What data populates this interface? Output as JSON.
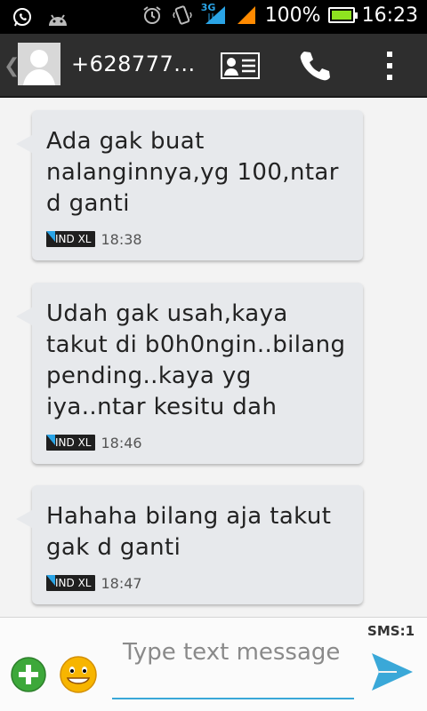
{
  "status_bar": {
    "network_type": "3G",
    "battery_percent": "100%",
    "battery_level": 1.0,
    "time": "16:23",
    "icons": [
      "whatsapp-icon",
      "android-icon",
      "alarm-icon",
      "vibrate-icon",
      "signal-3g-icon",
      "signal-icon",
      "battery-icon"
    ]
  },
  "action_bar": {
    "contact_name": "+628777...",
    "buttons": [
      "contact-card-icon",
      "phone-icon",
      "overflow-menu-icon"
    ]
  },
  "messages": [
    {
      "text": "Ada gak buat nalanginnya,yg 100,ntar d ganti",
      "sim": "IND XL",
      "time": "18:38"
    },
    {
      "text": "Udah gak usah,kaya takut di b0h0ngin..bilang pending..kaya yg iya..ntar kesitu dah",
      "sim": "IND XL",
      "time": "18:46"
    },
    {
      "text": "Hahaha bilang aja takut gak d ganti",
      "sim": "IND XL",
      "time": "18:47"
    }
  ],
  "compose": {
    "sms_counter": "SMS:1",
    "placeholder": "Type text message",
    "value": ""
  },
  "colors": {
    "accent": "#3aa8d8",
    "bubble": "#e7e9ec",
    "action_bar": "#2e2e2e",
    "battery": "#8fe320"
  }
}
